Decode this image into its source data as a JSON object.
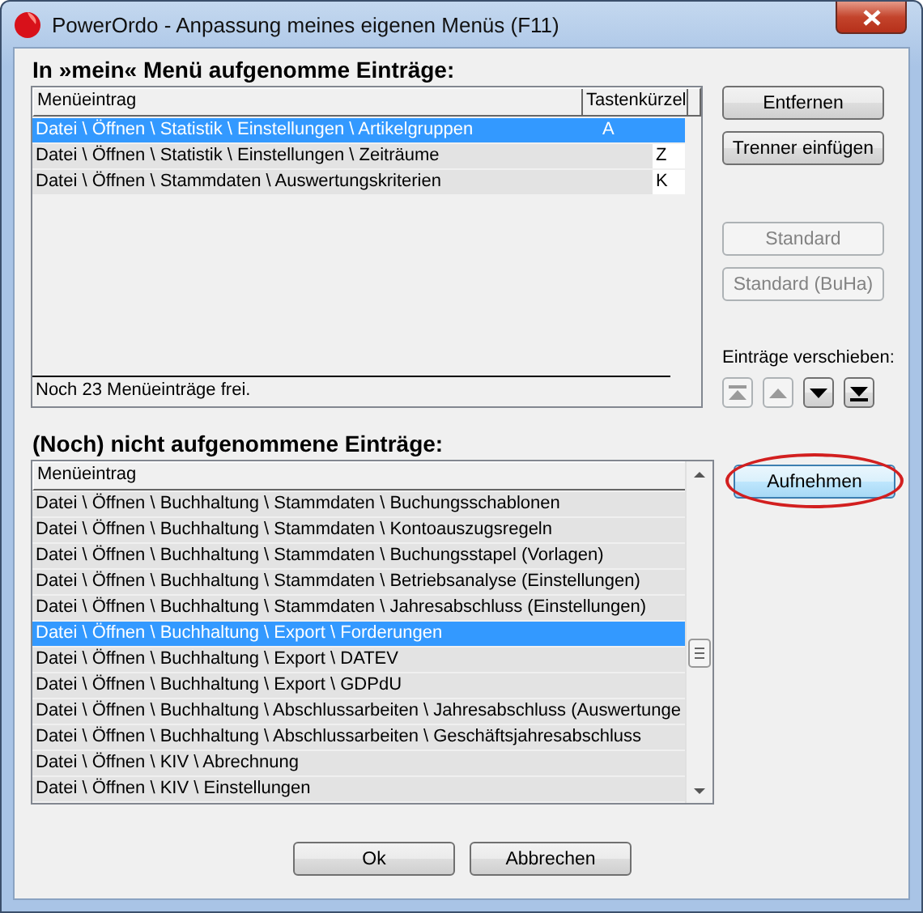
{
  "window": {
    "title": "PowerOrdo - Anpassung meines eigenen Menüs (F11)"
  },
  "included": {
    "heading": "In »mein« Menü aufgenomme Einträge:",
    "columns": [
      "Menüeintrag",
      "Tastenkürzel"
    ],
    "rows": [
      {
        "entry": "Datei \\ Öffnen \\ Statistik \\ Einstellungen \\ Artikelgruppen",
        "shortcut": "A",
        "selected": true
      },
      {
        "entry": "Datei \\ Öffnen \\ Statistik \\ Einstellungen \\ Zeiträume",
        "shortcut": "Z",
        "selected": false
      },
      {
        "entry": "Datei \\ Öffnen \\ Stammdaten \\ Auswertungskriterien",
        "shortcut": "K",
        "selected": false
      }
    ],
    "status": "Noch 23 Menüeinträge frei."
  },
  "side_buttons": [
    {
      "label": "Entfernen",
      "disabled": false
    },
    {
      "label": "Trenner einfügen",
      "disabled": false
    },
    {
      "label": "Standard",
      "disabled": true
    },
    {
      "label": "Standard (BuHa)",
      "disabled": true
    }
  ],
  "move": {
    "label": "Einträge verschieben:",
    "buttons": [
      {
        "kind": "top",
        "disabled": true
      },
      {
        "kind": "up",
        "disabled": true
      },
      {
        "kind": "down",
        "disabled": false
      },
      {
        "kind": "bottom",
        "disabled": false
      }
    ]
  },
  "available": {
    "heading": "(Noch) nicht aufgenommene Einträge:",
    "columns": [
      "Menüeintrag"
    ],
    "rows": [
      {
        "entry": "Datei \\ Öffnen \\ Buchhaltung \\ Stammdaten \\ Buchungsschablonen",
        "selected": false
      },
      {
        "entry": "Datei \\ Öffnen \\ Buchhaltung \\ Stammdaten \\ Kontoauszugsregeln",
        "selected": false
      },
      {
        "entry": "Datei \\ Öffnen \\ Buchhaltung \\ Stammdaten \\ Buchungsstapel (Vorlagen)",
        "selected": false
      },
      {
        "entry": "Datei \\ Öffnen \\ Buchhaltung \\ Stammdaten \\ Betriebsanalyse (Einstellungen)",
        "selected": false
      },
      {
        "entry": "Datei \\ Öffnen \\ Buchhaltung \\ Stammdaten \\ Jahresabschluss (Einstellungen)",
        "selected": false
      },
      {
        "entry": "Datei \\ Öffnen \\ Buchhaltung \\ Export \\ Forderungen",
        "selected": true
      },
      {
        "entry": "Datei \\ Öffnen \\ Buchhaltung \\ Export \\ DATEV",
        "selected": false
      },
      {
        "entry": "Datei \\ Öffnen \\ Buchhaltung \\ Export \\ GDPdU",
        "selected": false
      },
      {
        "entry": "Datei \\ Öffnen \\ Buchhaltung \\ Abschlussarbeiten \\ Jahresabschluss (Auswertunge",
        "selected": false
      },
      {
        "entry": "Datei \\ Öffnen \\ Buchhaltung \\ Abschlussarbeiten \\ Geschäftsjahresabschluss",
        "selected": false
      },
      {
        "entry": "Datei \\ Öffnen \\ KIV \\ Abrechnung",
        "selected": false
      },
      {
        "entry": "Datei \\ Öffnen \\ KIV \\ Einstellungen",
        "selected": false
      }
    ]
  },
  "add_button": {
    "label": "Aufnehmen",
    "circled": true
  },
  "footer_buttons": [
    {
      "label": "Ok"
    },
    {
      "label": "Abbrechen"
    }
  ]
}
